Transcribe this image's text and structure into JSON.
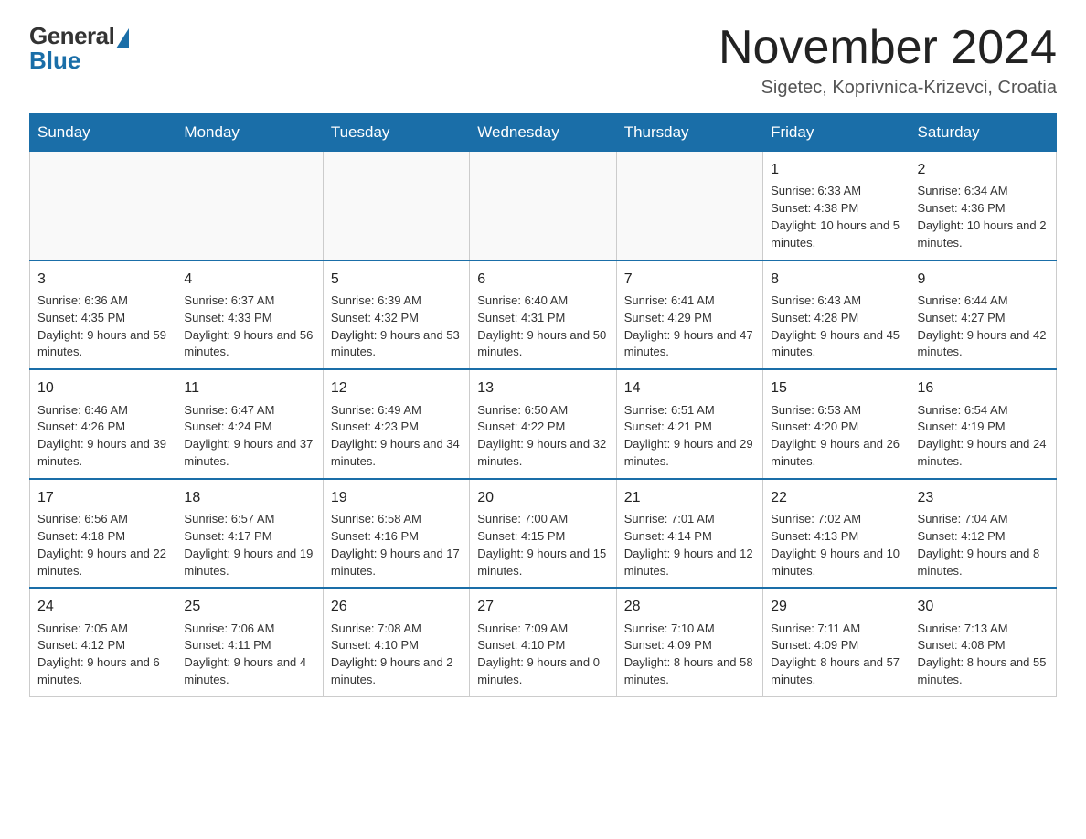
{
  "header": {
    "logo_general": "General",
    "logo_blue": "Blue",
    "title": "November 2024",
    "location": "Sigetec, Koprivnica-Krizevci, Croatia"
  },
  "days_of_week": [
    "Sunday",
    "Monday",
    "Tuesday",
    "Wednesday",
    "Thursday",
    "Friday",
    "Saturday"
  ],
  "weeks": [
    {
      "cells": [
        {
          "day": "",
          "info": ""
        },
        {
          "day": "",
          "info": ""
        },
        {
          "day": "",
          "info": ""
        },
        {
          "day": "",
          "info": ""
        },
        {
          "day": "",
          "info": ""
        },
        {
          "day": "1",
          "info": "Sunrise: 6:33 AM\nSunset: 4:38 PM\nDaylight: 10 hours and 5 minutes."
        },
        {
          "day": "2",
          "info": "Sunrise: 6:34 AM\nSunset: 4:36 PM\nDaylight: 10 hours and 2 minutes."
        }
      ]
    },
    {
      "cells": [
        {
          "day": "3",
          "info": "Sunrise: 6:36 AM\nSunset: 4:35 PM\nDaylight: 9 hours and 59 minutes."
        },
        {
          "day": "4",
          "info": "Sunrise: 6:37 AM\nSunset: 4:33 PM\nDaylight: 9 hours and 56 minutes."
        },
        {
          "day": "5",
          "info": "Sunrise: 6:39 AM\nSunset: 4:32 PM\nDaylight: 9 hours and 53 minutes."
        },
        {
          "day": "6",
          "info": "Sunrise: 6:40 AM\nSunset: 4:31 PM\nDaylight: 9 hours and 50 minutes."
        },
        {
          "day": "7",
          "info": "Sunrise: 6:41 AM\nSunset: 4:29 PM\nDaylight: 9 hours and 47 minutes."
        },
        {
          "day": "8",
          "info": "Sunrise: 6:43 AM\nSunset: 4:28 PM\nDaylight: 9 hours and 45 minutes."
        },
        {
          "day": "9",
          "info": "Sunrise: 6:44 AM\nSunset: 4:27 PM\nDaylight: 9 hours and 42 minutes."
        }
      ]
    },
    {
      "cells": [
        {
          "day": "10",
          "info": "Sunrise: 6:46 AM\nSunset: 4:26 PM\nDaylight: 9 hours and 39 minutes."
        },
        {
          "day": "11",
          "info": "Sunrise: 6:47 AM\nSunset: 4:24 PM\nDaylight: 9 hours and 37 minutes."
        },
        {
          "day": "12",
          "info": "Sunrise: 6:49 AM\nSunset: 4:23 PM\nDaylight: 9 hours and 34 minutes."
        },
        {
          "day": "13",
          "info": "Sunrise: 6:50 AM\nSunset: 4:22 PM\nDaylight: 9 hours and 32 minutes."
        },
        {
          "day": "14",
          "info": "Sunrise: 6:51 AM\nSunset: 4:21 PM\nDaylight: 9 hours and 29 minutes."
        },
        {
          "day": "15",
          "info": "Sunrise: 6:53 AM\nSunset: 4:20 PM\nDaylight: 9 hours and 26 minutes."
        },
        {
          "day": "16",
          "info": "Sunrise: 6:54 AM\nSunset: 4:19 PM\nDaylight: 9 hours and 24 minutes."
        }
      ]
    },
    {
      "cells": [
        {
          "day": "17",
          "info": "Sunrise: 6:56 AM\nSunset: 4:18 PM\nDaylight: 9 hours and 22 minutes."
        },
        {
          "day": "18",
          "info": "Sunrise: 6:57 AM\nSunset: 4:17 PM\nDaylight: 9 hours and 19 minutes."
        },
        {
          "day": "19",
          "info": "Sunrise: 6:58 AM\nSunset: 4:16 PM\nDaylight: 9 hours and 17 minutes."
        },
        {
          "day": "20",
          "info": "Sunrise: 7:00 AM\nSunset: 4:15 PM\nDaylight: 9 hours and 15 minutes."
        },
        {
          "day": "21",
          "info": "Sunrise: 7:01 AM\nSunset: 4:14 PM\nDaylight: 9 hours and 12 minutes."
        },
        {
          "day": "22",
          "info": "Sunrise: 7:02 AM\nSunset: 4:13 PM\nDaylight: 9 hours and 10 minutes."
        },
        {
          "day": "23",
          "info": "Sunrise: 7:04 AM\nSunset: 4:12 PM\nDaylight: 9 hours and 8 minutes."
        }
      ]
    },
    {
      "cells": [
        {
          "day": "24",
          "info": "Sunrise: 7:05 AM\nSunset: 4:12 PM\nDaylight: 9 hours and 6 minutes."
        },
        {
          "day": "25",
          "info": "Sunrise: 7:06 AM\nSunset: 4:11 PM\nDaylight: 9 hours and 4 minutes."
        },
        {
          "day": "26",
          "info": "Sunrise: 7:08 AM\nSunset: 4:10 PM\nDaylight: 9 hours and 2 minutes."
        },
        {
          "day": "27",
          "info": "Sunrise: 7:09 AM\nSunset: 4:10 PM\nDaylight: 9 hours and 0 minutes."
        },
        {
          "day": "28",
          "info": "Sunrise: 7:10 AM\nSunset: 4:09 PM\nDaylight: 8 hours and 58 minutes."
        },
        {
          "day": "29",
          "info": "Sunrise: 7:11 AM\nSunset: 4:09 PM\nDaylight: 8 hours and 57 minutes."
        },
        {
          "day": "30",
          "info": "Sunrise: 7:13 AM\nSunset: 4:08 PM\nDaylight: 8 hours and 55 minutes."
        }
      ]
    }
  ]
}
